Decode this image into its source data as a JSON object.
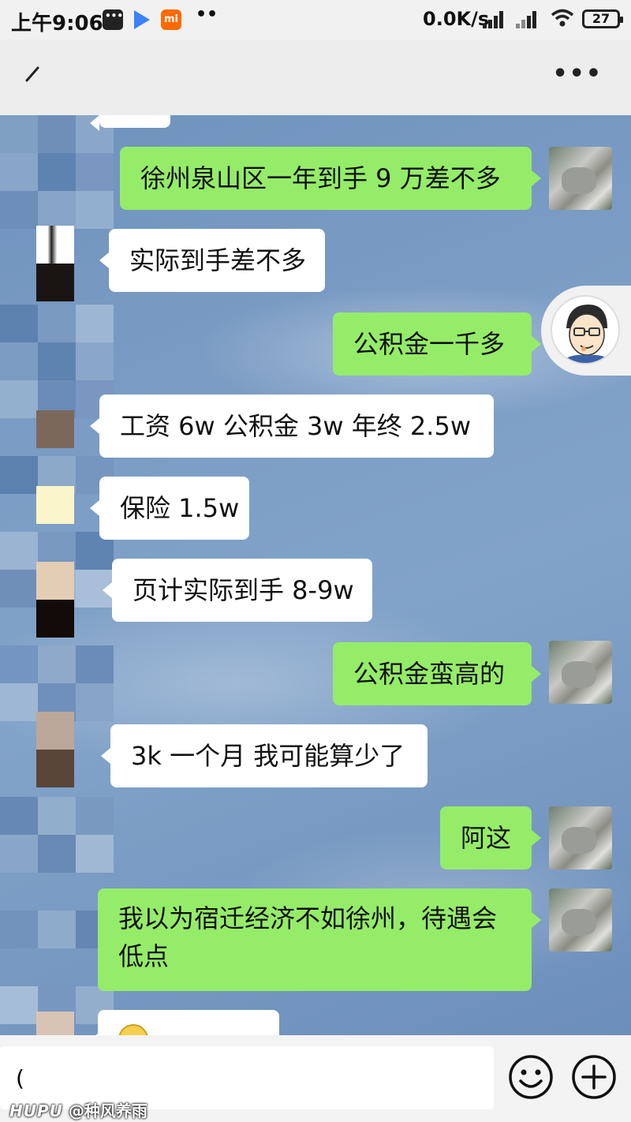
{
  "status_bar": {
    "time": "上午9:06",
    "net_speed": "0.0K/s",
    "battery": "27"
  },
  "header": {
    "title": ""
  },
  "messages": [
    {
      "side": "in",
      "text": ""
    },
    {
      "side": "out",
      "text": "徐州泉山区一年到手 9 万差不多"
    },
    {
      "side": "in",
      "text": "实际到手差不多"
    },
    {
      "side": "out",
      "text": "公积金一千多"
    },
    {
      "side": "in",
      "text": "工资 6w 公积金 3w 年终 2.5w"
    },
    {
      "side": "in",
      "text": "保险 1.5w"
    },
    {
      "side": "in",
      "text": "页计实际到手 8-9w"
    },
    {
      "side": "out",
      "text": "公积金蛮高的"
    },
    {
      "side": "in",
      "text": "3k 一个月  我可能算少了"
    },
    {
      "side": "out",
      "text": "阿这"
    },
    {
      "side": "out",
      "text": "我以为宿迁经济不如徐州，待遇会低点"
    },
    {
      "side": "in",
      "text": ""
    }
  ],
  "input": {
    "value": "("
  },
  "watermark": {
    "brand": "HUPU",
    "author": "@种风养雨"
  },
  "icons": {
    "back": "chevron-left-icon",
    "more": "more-icon",
    "emoji": "emoji-icon",
    "add": "plus-icon"
  },
  "colors": {
    "out_bubble": "#95ec69",
    "in_bubble": "#ffffff",
    "wifi": "#222222"
  }
}
